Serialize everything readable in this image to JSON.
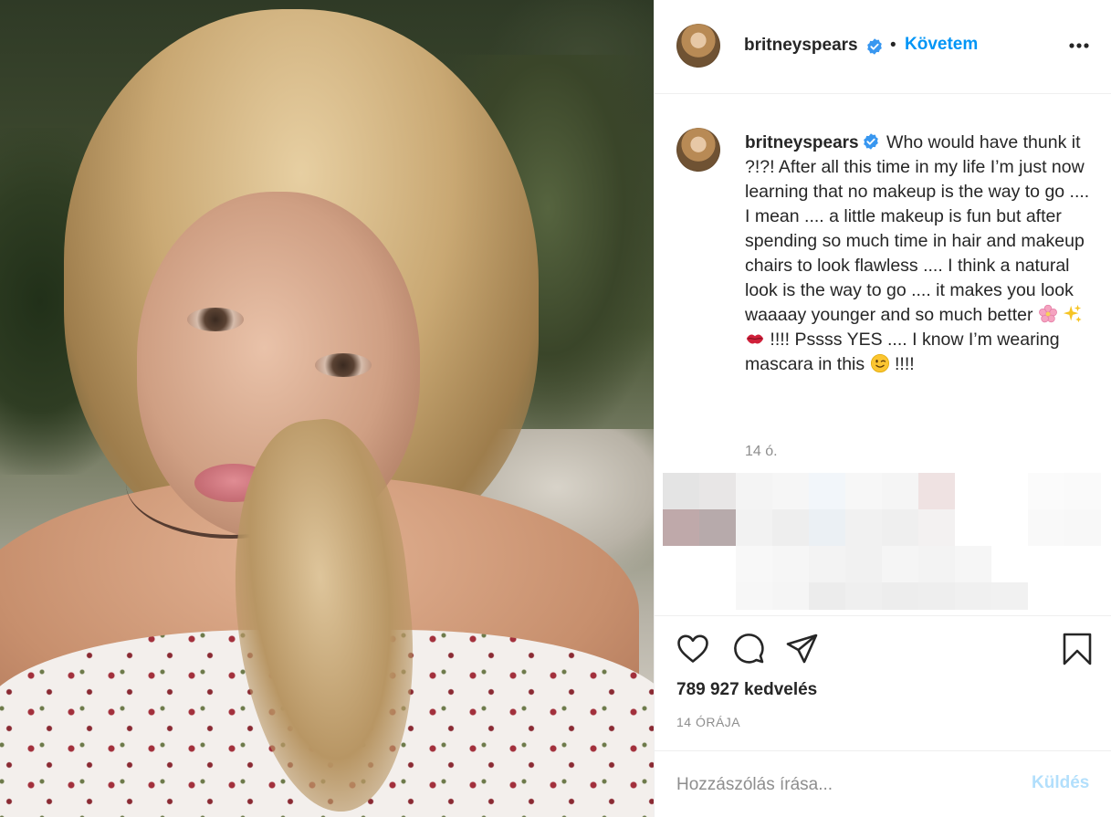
{
  "post": {
    "username": "britneyspears",
    "verified": true,
    "follow_separator": "•",
    "follow_label": "Követem",
    "caption_text": "Who would have thunk it ?!?! After all this time in my life I’m just now learning that no makeup is the way to go .... I mean .... a little makeup is fun but after spending so much time in hair and makeup chairs to look flawless .... I think a natural look is the way to go .... it makes you look waaaay younger and so much better",
    "caption_emojis": [
      "cherry-blossom-emoji",
      "sparkles-emoji",
      "kiss-mark-emoji"
    ],
    "caption_text_2": "!!!! Pssss YES .... I know I’m wearing mascara in this",
    "caption_emoji_2": "winking-face-emoji",
    "caption_text_3": "!!!!",
    "caption_time": "14 ó.",
    "likes": "789 927 kedvelés",
    "date": "14 ÓRÁJA"
  },
  "comment_box": {
    "placeholder": "Hozzászólás írása...",
    "post_label": "Küldés"
  },
  "colors": {
    "accent": "#0095f6",
    "post_button_disabled": "#b2dffc",
    "verified_badge": "#3897f0",
    "secondary_text": "#8e8e8e"
  },
  "icons": [
    "more-options-icon",
    "heart-icon",
    "comment-icon",
    "share-icon",
    "bookmark-icon",
    "verified-badge-icon"
  ]
}
